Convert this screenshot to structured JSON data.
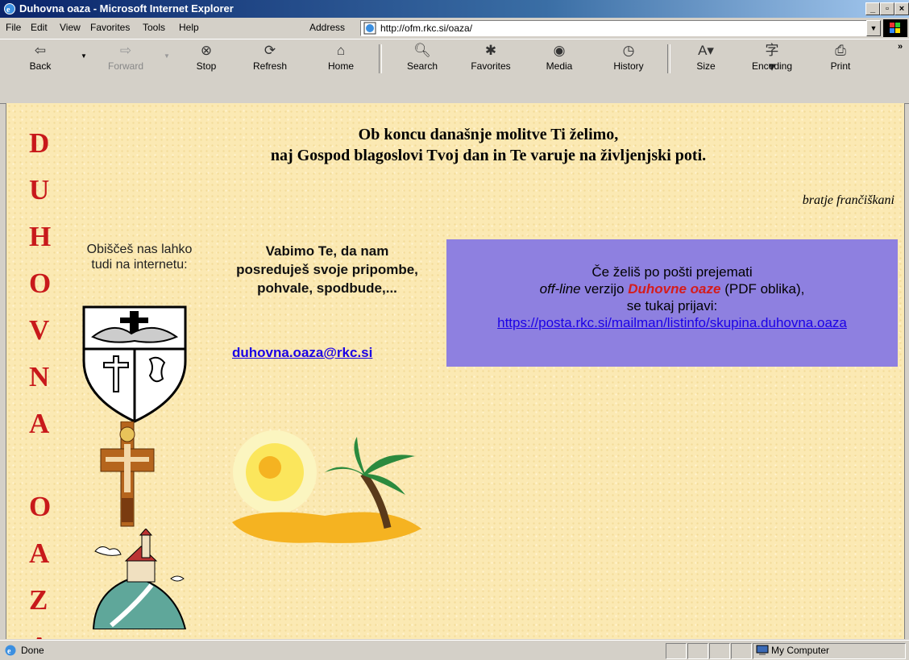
{
  "window": {
    "title": "Duhovna oaza - Microsoft Internet Explorer"
  },
  "menu": {
    "file": "File",
    "edit": "Edit",
    "view": "View",
    "favorites": "Favorites",
    "tools": "Tools",
    "help": "Help"
  },
  "address": {
    "label": "Address",
    "url": "http://ofm.rkc.si/oaza/"
  },
  "toolbar": {
    "back": "Back",
    "forward": "Forward",
    "stop": "Stop",
    "refresh": "Refresh",
    "home": "Home",
    "search": "Search",
    "favorites": "Favorites",
    "media": "Media",
    "history": "History",
    "size": "Size",
    "encoding": "Encoding",
    "print": "Print"
  },
  "page": {
    "side_letters": [
      "D",
      "U",
      "H",
      "O",
      "V",
      "N",
      "A",
      "",
      "O",
      "A",
      "Z",
      "A"
    ],
    "heading_line1": "Ob koncu današnje molitve Ti želimo,",
    "heading_line2": "naj Gospod blagoslovi Tvoj dan in Te varuje na življenjski poti.",
    "signoff": "bratje frančiškani",
    "visit_text": "Obiščeš nas lahko tudi na internetu:",
    "invite_text": "Vabimo Te, da nam posreduješ svoje pripombe, pohvale, spodbude,...",
    "email": "duhovna.oaza@rkc.si",
    "box": {
      "line1": "Če želiš po pošti prejemati",
      "offline": "off-line",
      "verzijo": " verzijo ",
      "brand": "Duhovne oaze",
      "pdf": " (PDF oblika),",
      "line3": "se tukaj prijavi:",
      "link": "https://posta.rkc.si/mailman/listinfo/skupina.duhovna.oaza"
    }
  },
  "status": {
    "text": "Done",
    "zone": "My Computer"
  }
}
